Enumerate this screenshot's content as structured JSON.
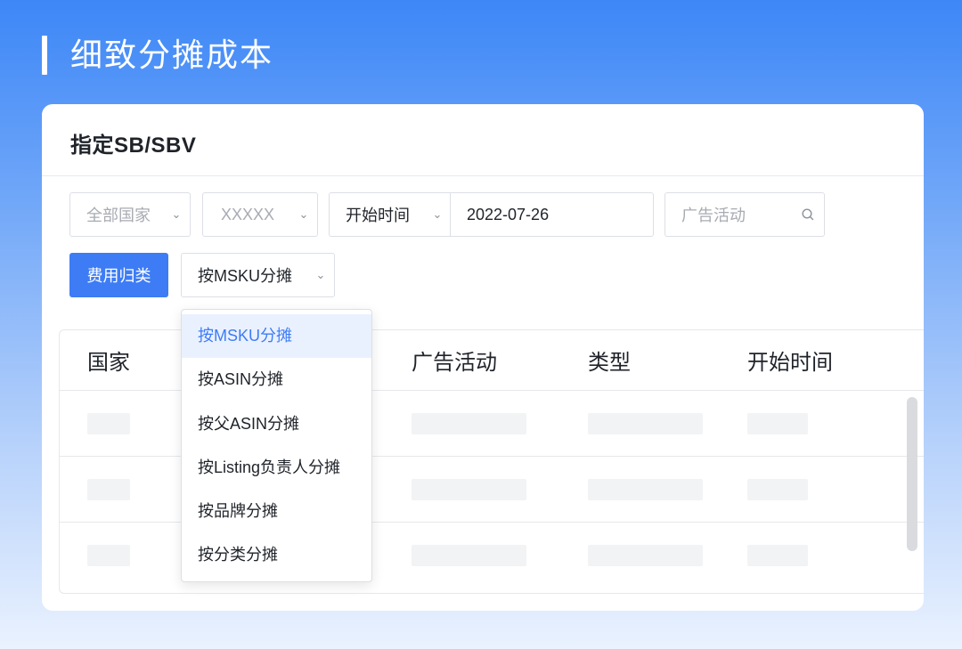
{
  "page": {
    "heading": "细致分摊成本"
  },
  "card": {
    "title": "指定SB/SBV"
  },
  "filters": {
    "country": "全部国家",
    "store": "XXXXX",
    "time_type": "开始时间",
    "date": "2022-07-26",
    "search_placeholder": "广告活动"
  },
  "actions": {
    "classify_button": "费用归类",
    "allocation_select": "按MSKU分摊"
  },
  "allocation_options": [
    {
      "label": "按MSKU分摊",
      "selected": true
    },
    {
      "label": "按ASIN分摊",
      "selected": false
    },
    {
      "label": "按父ASIN分摊",
      "selected": false
    },
    {
      "label": "按Listing负责人分摊",
      "selected": false
    },
    {
      "label": "按品牌分摊",
      "selected": false
    },
    {
      "label": "按分类分摊",
      "selected": false
    }
  ],
  "table": {
    "columns": [
      "国家",
      "广告活动",
      "类型",
      "开始时间"
    ],
    "placeholder_rows": 3
  },
  "colors": {
    "primary": "#3d7cf5",
    "active_option_bg": "#eaf1fe"
  },
  "icons": {
    "chevron": "chevron-down-icon",
    "search": "search-icon"
  }
}
